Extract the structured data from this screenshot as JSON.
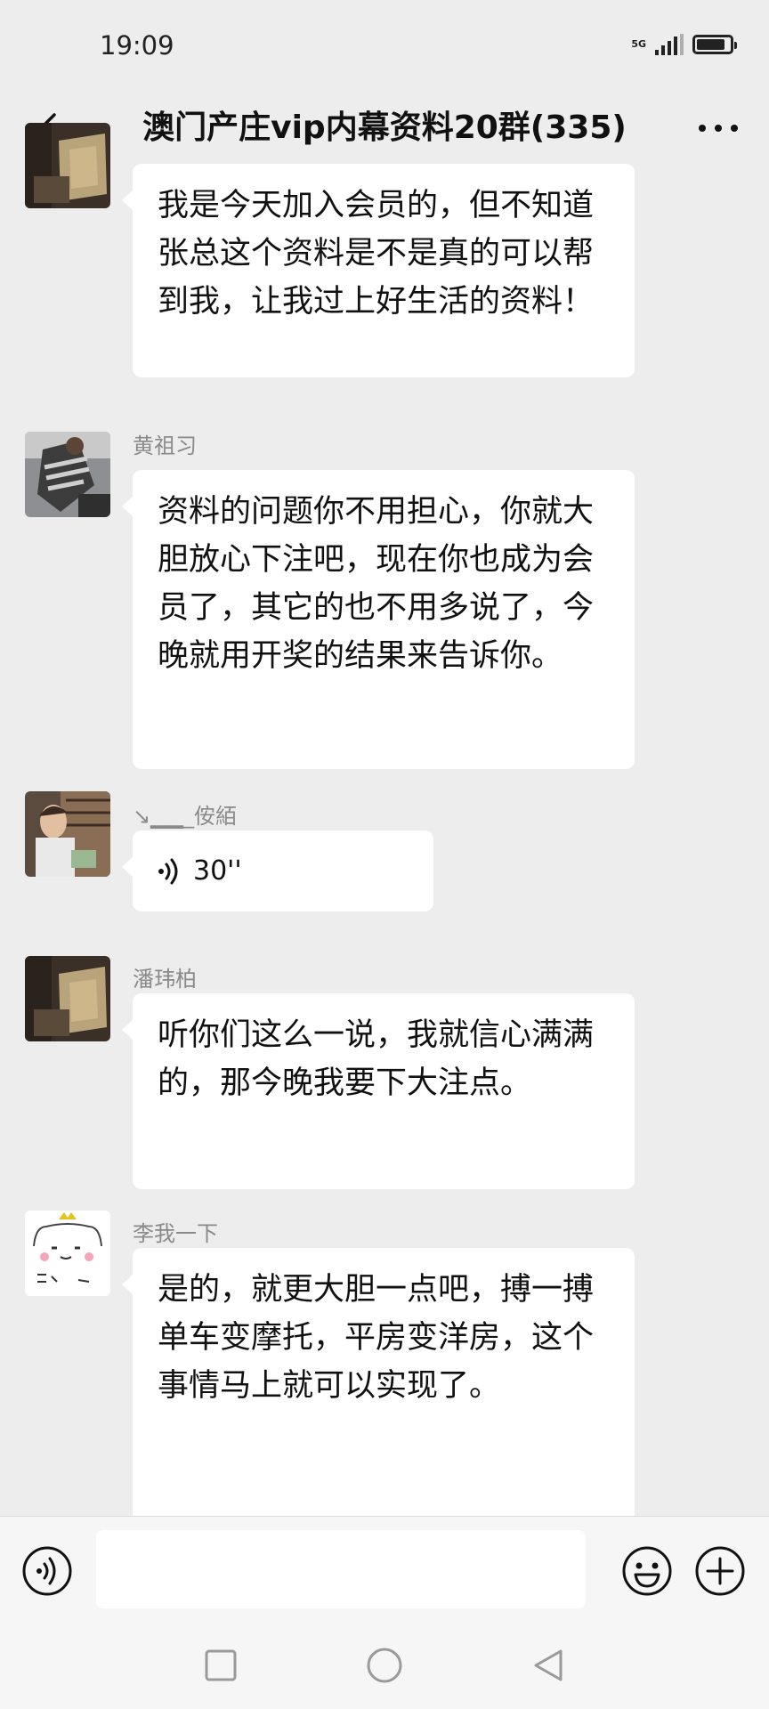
{
  "status_bar": {
    "time": "19:09",
    "network": "5G",
    "signal_level": 0.8,
    "battery_level": 0.85,
    "icons": [
      "signal-icon",
      "battery-icon"
    ]
  },
  "header": {
    "back_icon": "chevron-left-icon",
    "title": "澳门产庄vip内幕资料20群(335)",
    "more_icon": "more-dots-icon"
  },
  "messages": [
    {
      "sender": "",
      "type": "text",
      "text": "我是今天加入会员的，但不知道张总这个资料是不是真的可以帮到我，让我过上好生活的资料！"
    },
    {
      "sender": "黄祖习",
      "type": "text",
      "text": "资料的问题你不用担心，你就大胆放心下注吧，现在你也成为会员了，其它的也不用多说了，今晚就用开奖的结果来告诉你。"
    },
    {
      "sender": "↘▁▁_侒絔",
      "type": "voice",
      "duration": "30''"
    },
    {
      "sender": "潘玮柏",
      "type": "text",
      "text": "听你们这么一说，我就信心满满的，那今晚我要下大注点。"
    },
    {
      "sender": "李我一下",
      "type": "text",
      "text": "是的，就更大胆一点吧，搏一搏单车变摩托，平房变洋房，这个事情马上就可以实现了。"
    }
  ],
  "input_bar": {
    "voice_icon": "voice-input-icon",
    "placeholder": "",
    "emoji_icon": "emoji-icon",
    "plus_icon": "plus-icon"
  },
  "system_nav": {
    "icons": [
      "recent-apps-icon",
      "home-icon",
      "back-triangle-icon"
    ]
  },
  "colors": {
    "background": "#ededed",
    "bubble": "#ffffff",
    "name_text": "#8a8a8a",
    "text": "#111111"
  }
}
